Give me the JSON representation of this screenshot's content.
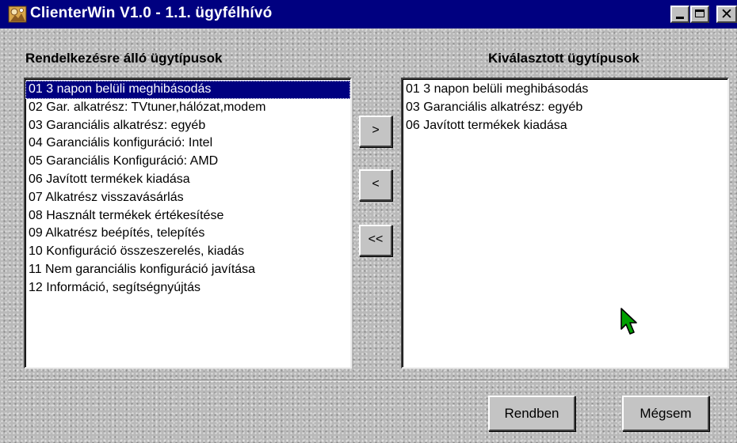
{
  "window": {
    "title": "ClienterWin V1.0 - 1.1. ügyfélhívó",
    "app_icon": "clienterwin-app-icon",
    "title_bar_color": "#000080",
    "controls": {
      "minimize": "minimize-icon",
      "maximize": "maximize-icon",
      "close": "close-icon",
      "close_glyph": "✕"
    }
  },
  "available": {
    "heading": "Rendelkezésre álló ügytípusok",
    "selected_index": 0,
    "items": [
      "01 3 napon belüli meghibásodás",
      "02 Gar. alkatrész: TVtuner,hálózat,modem",
      "03 Garanciális alkatrész: egyéb",
      "04 Garanciális konfiguráció: Intel",
      "05 Garanciális Konfiguráció: AMD",
      "06 Javított termékek kiadása",
      "07 Alkatrész visszavásárlás",
      "08 Használt termékek értékesítése",
      "09 Alkatrész beépítés, telepítés",
      "10 Konfiguráció összeszerelés, kiadás",
      "11 Nem garanciális konfiguráció javítása",
      "12 Információ, segítségnyújtás"
    ]
  },
  "selected": {
    "heading": "Kiválasztott ügytípusok",
    "items": [
      "01 3 napon belüli meghibásodás",
      "03 Garanciális alkatrész: egyéb",
      "06 Javított termékek kiadása"
    ]
  },
  "transfer_buttons": {
    "add": ">",
    "remove": "<",
    "remove_all": "<<"
  },
  "dialog_buttons": {
    "ok": "Rendben",
    "cancel": "Mégsem"
  },
  "colors": {
    "selection": "#000080",
    "face": "#c0c0c0",
    "cursor": "#00a000"
  },
  "cursor_icon": "mouse-pointer-icon"
}
